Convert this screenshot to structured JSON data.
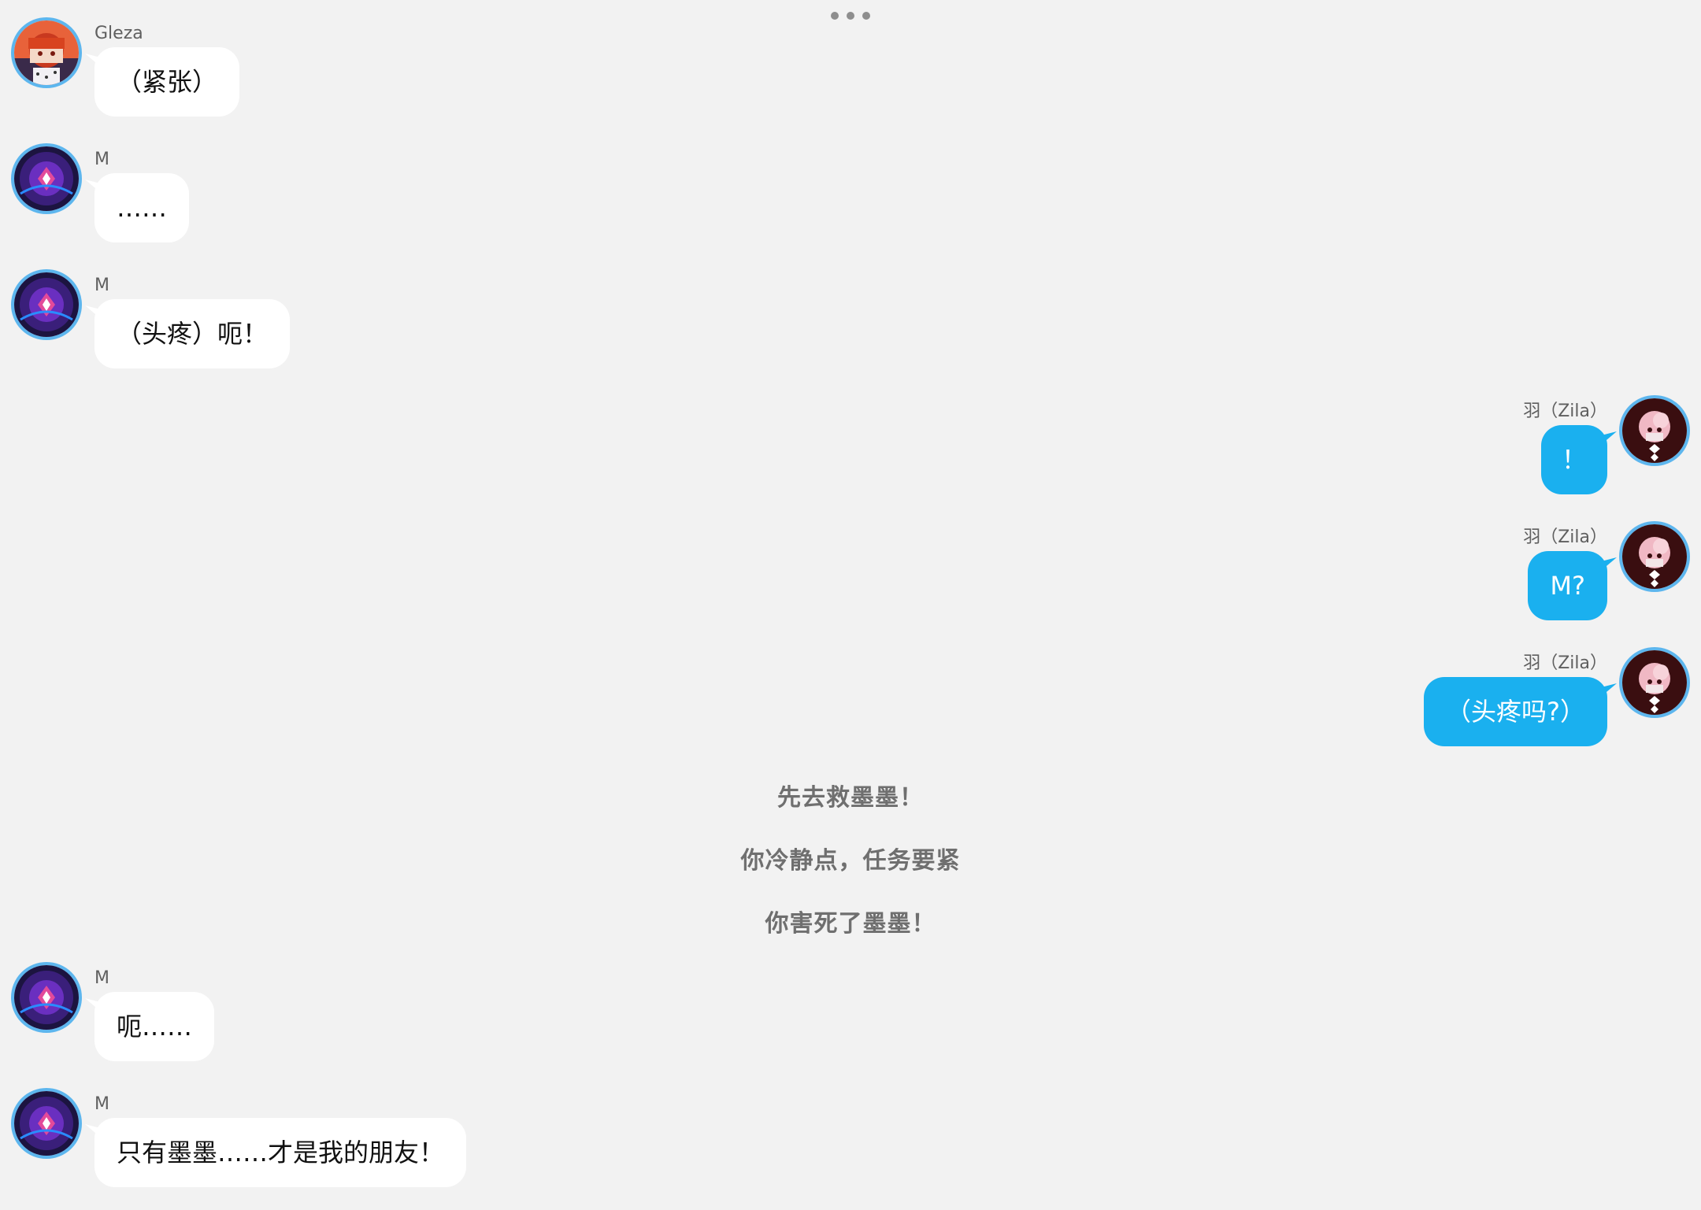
{
  "header": {
    "more_icon": "more-horizontal-icon"
  },
  "speakers": {
    "gleza": {
      "name": "Gleza",
      "avatar_icon": "gleza-avatar"
    },
    "m": {
      "name": "M",
      "avatar_icon": "m-avatar"
    },
    "zila": {
      "name": "羽（Zila）",
      "avatar_icon": "zila-avatar"
    }
  },
  "messages": [
    {
      "speaker": "Gleza",
      "side": "left",
      "text": "（紧张）"
    },
    {
      "speaker": "M",
      "side": "left",
      "text": "……"
    },
    {
      "speaker": "M",
      "side": "left",
      "text": "（头疼）呃！"
    },
    {
      "speaker": "羽（Zila）",
      "side": "right",
      "text": "！"
    },
    {
      "speaker": "羽（Zila）",
      "side": "right",
      "text": "M?"
    },
    {
      "speaker": "羽（Zila）",
      "side": "right",
      "text": "（头疼吗?）"
    },
    {
      "speaker": "M",
      "side": "left",
      "text": "呃……"
    },
    {
      "speaker": "M",
      "side": "left",
      "text": "只有墨墨……才是我的朋友！"
    }
  ],
  "narration": [
    "先去救墨墨！",
    "你冷静点，任务要紧",
    "你害死了墨墨！"
  ],
  "colors": {
    "background": "#f2f2f2",
    "left_bubble": "#ffffff",
    "right_bubble": "#1ab0ef",
    "avatar_ring": "#5db6ee"
  }
}
